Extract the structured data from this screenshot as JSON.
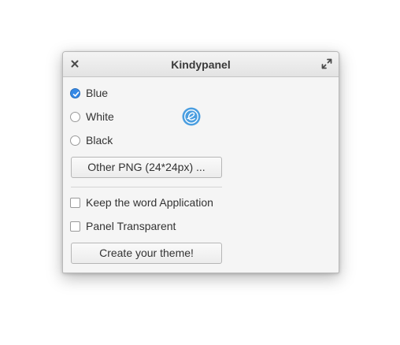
{
  "window": {
    "title": "Kindypanel",
    "close_icon": "close-icon",
    "maximize_icon": "maximize-icon"
  },
  "theme_options": [
    {
      "label": "Blue",
      "checked": true
    },
    {
      "label": "White",
      "checked": false
    },
    {
      "label": "Black",
      "checked": false
    }
  ],
  "logo_icon": "elementary-logo-icon",
  "other_png_button": "Other PNG (24*24px) ...",
  "checkboxes": [
    {
      "label": "Keep the word Application",
      "checked": false
    },
    {
      "label": "Panel Transparent",
      "checked": false
    }
  ],
  "create_button": "Create your theme!",
  "colors": {
    "accent": "#3689e6",
    "logo": "#4a9ee0"
  }
}
